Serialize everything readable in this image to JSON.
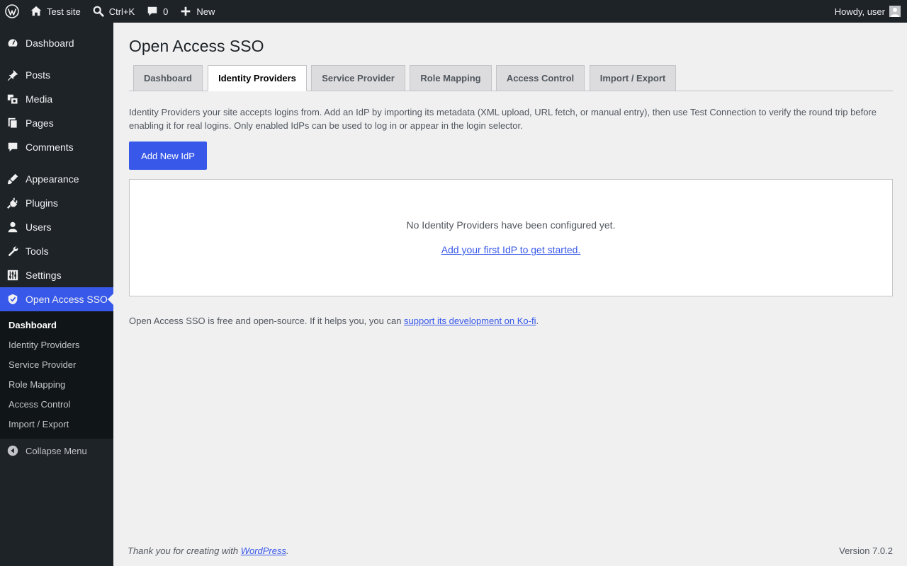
{
  "adminbar": {
    "site_name": "Test site",
    "search_shortcut": "Ctrl+K",
    "comments_count": "0",
    "new_label": "New",
    "howdy": "Howdy, user"
  },
  "sidebar": {
    "items": [
      {
        "label": "Dashboard",
        "icon": "dashboard-icon"
      },
      {
        "label": "Posts",
        "icon": "pin-icon"
      },
      {
        "label": "Media",
        "icon": "media-icon"
      },
      {
        "label": "Pages",
        "icon": "pages-icon"
      },
      {
        "label": "Comments",
        "icon": "comment-icon"
      },
      {
        "label": "Appearance",
        "icon": "brush-icon"
      },
      {
        "label": "Plugins",
        "icon": "plug-icon"
      },
      {
        "label": "Users",
        "icon": "user-icon"
      },
      {
        "label": "Tools",
        "icon": "wrench-icon"
      },
      {
        "label": "Settings",
        "icon": "sliders-icon"
      },
      {
        "label": "Open Access SSO",
        "icon": "shield-icon"
      }
    ],
    "submenu": [
      "Dashboard",
      "Identity Providers",
      "Service Provider",
      "Role Mapping",
      "Access Control",
      "Import / Export"
    ],
    "collapse_label": "Collapse Menu"
  },
  "main": {
    "title": "Open Access SSO",
    "tabs": [
      "Dashboard",
      "Identity Providers",
      "Service Provider",
      "Role Mapping",
      "Access Control",
      "Import / Export"
    ],
    "active_tab": "Identity Providers",
    "description": "Identity Providers your site accepts logins from. Add an IdP by importing its metadata (XML upload, URL fetch, or manual entry), then use Test Connection to verify the round trip before enabling it for real logins. Only enabled IdPs can be used to log in or appear in the login selector.",
    "add_button": "Add New IdP",
    "empty_message": "No Identity Providers have been configured yet.",
    "empty_link": "Add your first IdP to get started.",
    "note_prefix": "Open Access SSO is free and open-source. If it helps you, you can ",
    "note_link": "support its development on Ko-fi",
    "note_suffix": "."
  },
  "footer": {
    "thanks_prefix": "Thank you for creating with ",
    "thanks_link": "WordPress",
    "thanks_suffix": ".",
    "version": "Version 7.0.2"
  },
  "colors": {
    "accent": "#3858e9",
    "admin_bg": "#1d2327",
    "page_bg": "#f0f0f1"
  }
}
